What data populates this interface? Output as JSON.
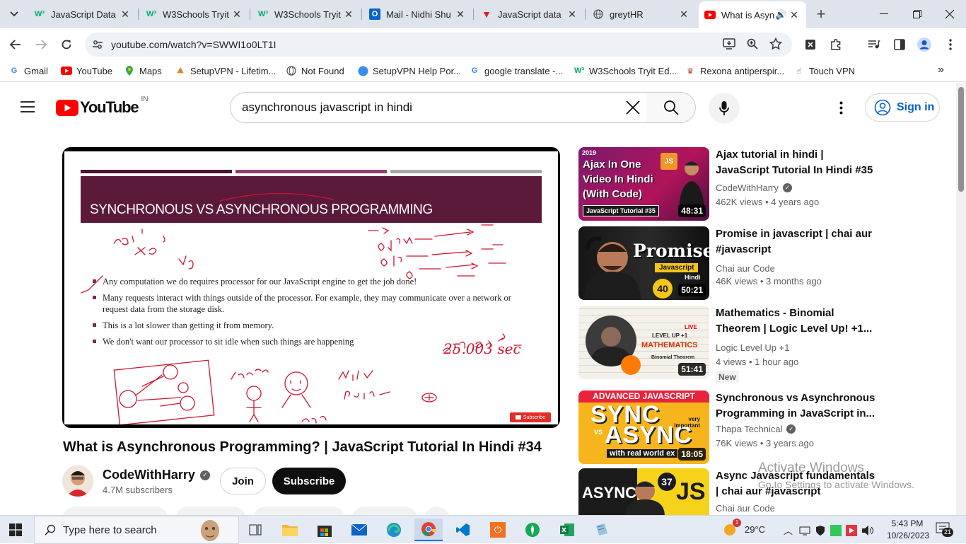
{
  "tabs": [
    {
      "title": "JavaScript Data",
      "icon": "w3schools-icon"
    },
    {
      "title": "W3Schools Tryit",
      "icon": "w3schools-icon"
    },
    {
      "title": "W3Schools Tryit",
      "icon": "w3schools-icon"
    },
    {
      "title": "Mail - Nidhi Shu",
      "icon": "outlook-icon"
    },
    {
      "title": "JavaScript data",
      "icon": "vivaldi-icon"
    },
    {
      "title": "greytHR",
      "icon": "globe-icon"
    },
    {
      "title": "What is Asyn",
      "icon": "youtube-icon",
      "active": true
    }
  ],
  "address_bar": {
    "url": "youtube.com/watch?v=SWWI1o0LT1I"
  },
  "bookmarks": [
    {
      "label": "Gmail"
    },
    {
      "label": "YouTube"
    },
    {
      "label": "Maps"
    },
    {
      "label": "SetupVPN - Lifetim..."
    },
    {
      "label": "Not Found"
    },
    {
      "label": "SetupVPN Help Por..."
    },
    {
      "label": "google translate -..."
    },
    {
      "label": "W3Schools Tryit Ed..."
    },
    {
      "label": "Rexona antiperspir..."
    },
    {
      "label": "Touch VPN"
    }
  ],
  "youtube": {
    "logo_text": "YouTube",
    "country": "IN",
    "search_value": "asynchronous javascript in hindi",
    "signin_label": "Sign in"
  },
  "video": {
    "slide_title": "SYNCHRONOUS VS ASYNCHRONOUS PROGRAMMING",
    "bullets": [
      "Any computation we do requires processor for our JavaScript engine to get the job done!",
      "Many requests interact with things outside of the processor. For example, they may communicate over a network or request data from the storage disk.",
      "This is a lot slower than getting it from memory.",
      "We don't want our processor to sit idle when such things are happening"
    ],
    "subscribe_badge": "Subscribe",
    "title": "What is Asynchronous Programming? | JavaScript Tutorial In Hindi #34",
    "channel": "CodeWithHarry",
    "subscribers": "4.7M subscribers",
    "join_label": "Join",
    "subscribe_label": "Subscribe"
  },
  "suggestions": [
    {
      "title": "Ajax tutorial in hindi | JavaScript Tutorial In Hindi #35",
      "channel": "CodeWithHarry",
      "verified": true,
      "views": "462K views",
      "age": "4 years ago",
      "duration": "48:31",
      "thumb_text": [
        "Ajax In One",
        "Video In Hindi",
        "(With Code)"
      ],
      "thumb_tag": "JavaScript Tutorial #35",
      "thumb_year": "2019",
      "thumb_badge": "JS"
    },
    {
      "title": "Promise in javascript | chai aur #javascript",
      "channel": "Chai aur Code",
      "verified": false,
      "views": "46K views",
      "age": "3 months ago",
      "duration": "50:21",
      "thumb_text": [
        "Promise",
        "Javascript",
        "Hindi"
      ],
      "thumb_num": "40"
    },
    {
      "title": "Mathematics - Binomial Theorem | Logic Level Up! +1...",
      "channel": "Logic Level Up +1",
      "verified": false,
      "views": "4 views",
      "age": "1 hour ago",
      "duration": "51:41",
      "badge": "New",
      "thumb_text": [
        "LEVEL UP +1",
        "MATHEMATICS",
        "Binomial Theorem"
      ],
      "thumb_live": "LIVE"
    },
    {
      "title": "Synchronous vs Asynchronous Programming in JavaScript in...",
      "channel": "Thapa Technical",
      "verified": true,
      "views": "76K views",
      "age": "3 years ago",
      "duration": "18:05",
      "thumb_text": [
        "ADVANCED JAVASCRIPT",
        "SYNC",
        "ASYNC",
        "very important",
        "with real world ex"
      ],
      "thumb_vs": "VS"
    },
    {
      "title": "Async Javascript fundamentals | chai aur #javascript",
      "channel": "Chai aur Code",
      "verified": false,
      "views": "",
      "age": "",
      "thumb_text": [
        "ASYNC",
        "JS"
      ],
      "thumb_num": "37"
    }
  ],
  "activation": {
    "title": "Activate Windows",
    "subtitle": "Go to Settings to activate Windows."
  },
  "taskbar": {
    "search_placeholder": "Type here to search",
    "weather": "29°C",
    "weather_badge": "1",
    "time": "5:43 PM",
    "date": "10/26/2023",
    "notification_count": "21"
  },
  "colors": {
    "youtube_red": "#ff0000",
    "slide_band": "#5c1a3a",
    "link_blue": "#065fd4"
  }
}
